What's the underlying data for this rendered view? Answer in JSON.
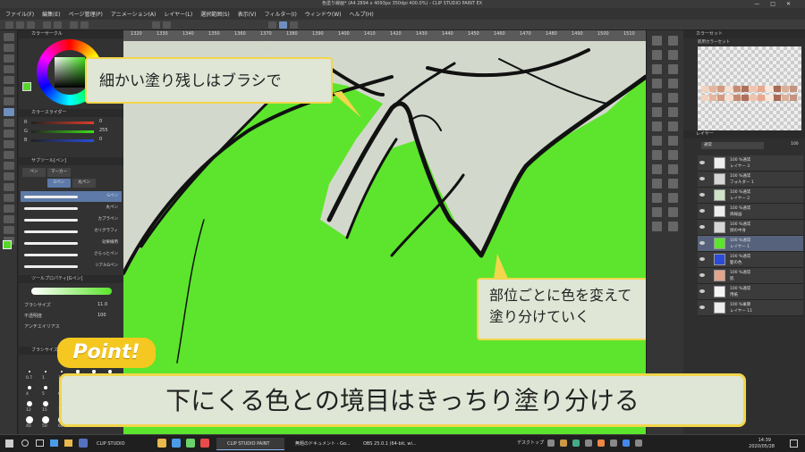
{
  "window": {
    "title": "色塗り線画* (A4 2894 x 4093px 350dpi 400.0%) - CLIP STUDIO PAINT EX"
  },
  "menu": [
    "ファイル(F)",
    "編集(E)",
    "ページ管理(P)",
    "アニメーション(A)",
    "レイヤー(L)",
    "選択範囲(S)",
    "表示(V)",
    "フィルター(I)",
    "ウィンドウ(W)",
    "ヘルプ(H)"
  ],
  "left_panel": {
    "color_wheel_title": "カラーサークル",
    "color_slider_title": "カラースライダー",
    "sliders": [
      {
        "label": "R",
        "value": "0",
        "color": "#e03c2a"
      },
      {
        "label": "G",
        "value": "255",
        "color": "#3ee01a"
      },
      {
        "label": "B",
        "value": "0",
        "color": "#2a4ce0"
      }
    ],
    "subtool_title": "サブツール[ペン]",
    "subtools": [
      "ペン",
      "マーカー",
      "Gペン",
      "丸ペン"
    ],
    "brushes": [
      {
        "name": "Gペン",
        "selected": true
      },
      {
        "name": "丸ペン",
        "selected": false
      },
      {
        "name": "カブラペン",
        "selected": false
      },
      {
        "name": "カリグラフィ",
        "selected": false
      },
      {
        "name": "効果線用",
        "selected": false
      },
      {
        "name": "さらっとペン",
        "selected": false
      },
      {
        "name": "リアルGペン",
        "selected": false
      }
    ],
    "tool_property_title": "ツールプロパティ[Gペン]",
    "properties": [
      {
        "label": "ブラシサイズ",
        "value": "11.0"
      },
      {
        "label": "不透明度",
        "value": "100"
      },
      {
        "label": "アンチエイリアス",
        "value": ""
      }
    ],
    "brush_size_title": "ブラシサイズ",
    "brush_sizes": [
      "0.7",
      "1",
      "1.5",
      "2",
      "2.5",
      "3",
      "4",
      "5",
      "6",
      "7",
      "8",
      "10",
      "12",
      "15",
      "17",
      "20",
      "25",
      "30",
      "40",
      "50",
      "60",
      "70",
      "80",
      "100"
    ]
  },
  "canvas": {
    "tab_label": "色塗り線画",
    "ruler_ticks": [
      "1320",
      "1330",
      "1340",
      "1350",
      "1360",
      "1370",
      "1380",
      "1390",
      "1400",
      "1410",
      "1420",
      "1430",
      "1440",
      "1450",
      "1460",
      "1470",
      "1480",
      "1490",
      "1500",
      "1510"
    ],
    "fill_color": "#5ce52c",
    "base_color": "#d3d8cc",
    "line_color": "#111111"
  },
  "callouts": {
    "top_left": "細かい塗り残しはブラシで",
    "right_line1": "部位ごとに色を変えて",
    "right_line2": "塗り分けていく"
  },
  "point": {
    "badge": "Point!",
    "text": "下にくる色との境目はきっちり塗り分ける"
  },
  "right_panel": {
    "palette_title": "カラーセット",
    "palette_name": "肌用カラーセット",
    "layer_title": "レイヤー",
    "blend_mode": "通常",
    "opacity": "100",
    "layers": [
      {
        "mode": "100 %通常",
        "name": "レイヤー 3",
        "selected": false
      },
      {
        "mode": "100 %通常",
        "name": "フォルダー 1",
        "selected": false
      },
      {
        "mode": "100 %通常",
        "name": "レイヤー 2",
        "selected": false
      },
      {
        "mode": "100 %通常",
        "name": "目線画",
        "selected": false
      },
      {
        "mode": "100 %通常",
        "name": "顔の中身",
        "selected": false
      },
      {
        "mode": "100 %通常",
        "name": "レイヤー 1",
        "selected": true
      },
      {
        "mode": "100 %通常",
        "name": "髪の色",
        "selected": false
      },
      {
        "mode": "100 %通常",
        "name": "肌",
        "selected": false
      },
      {
        "mode": "100 %通常",
        "name": "用紙",
        "selected": false
      },
      {
        "mode": "100 %乗算",
        "name": "レイヤー 11",
        "selected": false
      }
    ]
  },
  "taskbar": {
    "items": [
      {
        "label": "CLIP STUDIO",
        "active": false
      },
      {
        "label": "CLIP STUDIO PAINT",
        "active": true
      },
      {
        "label": "無題のドキュメント - Go...",
        "active": false
      },
      {
        "label": "OBS 25.0.1 (64-bit, wi...",
        "active": false
      }
    ],
    "desktop_label": "デスクトップ",
    "time": "14:39",
    "date": "2020/05/28"
  },
  "colors": {
    "accent": "#f2d64b",
    "point_badge": "#f4c820",
    "callout_bg": "#dfe6d6"
  }
}
